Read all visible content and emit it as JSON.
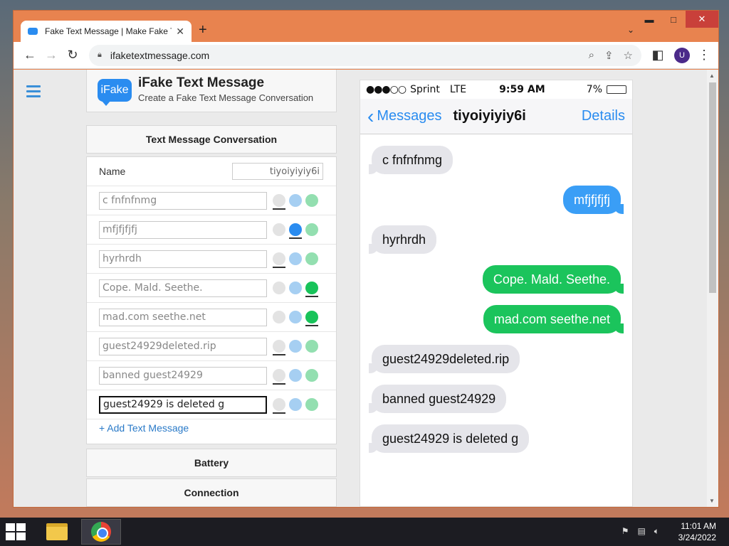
{
  "browser": {
    "tab_title": "Fake Text Message | Make Fake T",
    "tab_close": "✕",
    "new_tab": "+",
    "url": "ifaketextmessage.com",
    "profile_initial": "U",
    "window_buttons": {
      "minimize": "▬",
      "maximize": "□",
      "close": "✕"
    }
  },
  "site": {
    "logo_text": "iFake",
    "title": "iFake Text Message",
    "subtitle": "Create a Fake Text Message Conversation"
  },
  "sections": {
    "conversation": "Text Message Conversation",
    "battery": "Battery",
    "connection": "Connection"
  },
  "form": {
    "name_label": "Name",
    "name_value": "tiyoiyiyiy6i",
    "add_message": "+ Add Text Message",
    "messages": [
      {
        "text": "c fnfnfnmg",
        "type": "gray"
      },
      {
        "text": "mfjfjfjfj",
        "type": "blue"
      },
      {
        "text": "hyrhrdh",
        "type": "gray"
      },
      {
        "text": "Cope. Mald. Seethe.",
        "type": "green"
      },
      {
        "text": "mad.com seethe.net",
        "type": "green"
      },
      {
        "text": "guest24929deleted.rip",
        "type": "gray"
      },
      {
        "text": "banned guest24929",
        "type": "gray"
      },
      {
        "text": "guest24929 is deleted g",
        "type": "gray"
      }
    ]
  },
  "phone": {
    "signal": "●●●○○",
    "carrier": "Sprint",
    "network": "LTE",
    "time": "9:59 AM",
    "battery": "7%",
    "battery_level": 0.07,
    "back_label": "Messages",
    "contact": "tiyoiyiyiy6i",
    "details": "Details",
    "thread": [
      {
        "text": "c fnfnfnmg",
        "side": "recv"
      },
      {
        "text": "mfjfjfjfj",
        "side": "sent-blue"
      },
      {
        "text": "hyrhrdh",
        "side": "recv"
      },
      {
        "text": "Cope. Mald. Seethe.",
        "side": "sent-green"
      },
      {
        "text": "mad.com seethe.net",
        "side": "sent-green"
      },
      {
        "text": "guest24929deleted.rip",
        "side": "recv"
      },
      {
        "text": "banned guest24929",
        "side": "recv"
      },
      {
        "text": "guest24929 is deleted g",
        "side": "recv"
      }
    ]
  },
  "taskbar": {
    "time": "11:01 AM",
    "date": "3/24/2022"
  },
  "colors": {
    "accent": "#2a8cf0",
    "imessage_blue": "#3a9ef6",
    "sms_green": "#1bc45c",
    "received_gray": "#e5e5ea"
  }
}
